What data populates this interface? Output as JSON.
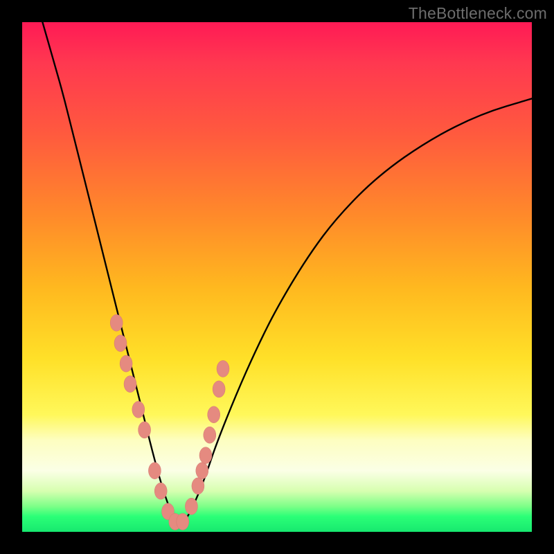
{
  "watermark": "TheBottleneck.com",
  "chart_data": {
    "type": "line",
    "title": "",
    "xlabel": "",
    "ylabel": "",
    "xlim": [
      0,
      100
    ],
    "ylim": [
      0,
      100
    ],
    "grid": false,
    "legend": false,
    "description": "Bottleneck curve: steep descent from top-left, minimum around x≈30, asymptotic rise toward right. Y encodes bottleneck severity (top=red/high, bottom=green/low). Salmon dots mark highlighted sample points near the valley.",
    "series": [
      {
        "name": "bottleneck-curve",
        "x": [
          4,
          6,
          8,
          10,
          12,
          14,
          16,
          18,
          20,
          22,
          24,
          26,
          28,
          30,
          32,
          34,
          36,
          38,
          42,
          46,
          50,
          56,
          62,
          70,
          80,
          90,
          100
        ],
        "y": [
          100,
          93,
          86,
          78,
          70,
          62,
          54,
          46,
          38,
          30,
          22,
          14,
          7,
          2,
          2,
          6,
          11,
          17,
          27,
          36,
          44,
          54,
          62,
          70,
          77,
          82,
          85
        ]
      }
    ],
    "highlight_points": {
      "name": "sample-dots",
      "x": [
        18.5,
        19.3,
        20.4,
        21.2,
        22.8,
        24.0,
        26.0,
        27.2,
        28.6,
        30.0,
        31.5,
        33.2,
        34.5,
        35.3,
        36.0,
        36.8,
        37.6,
        38.6,
        39.4
      ],
      "y": [
        41,
        37,
        33,
        29,
        24,
        20,
        12,
        8,
        4,
        2,
        2,
        5,
        9,
        12,
        15,
        19,
        23,
        28,
        32
      ]
    },
    "background_gradient": {
      "top": "#ff1a55",
      "upper_mid": "#ff8a2a",
      "mid": "#ffe028",
      "lower_mid": "#fdfec0",
      "bottom": "#17e86f"
    }
  }
}
